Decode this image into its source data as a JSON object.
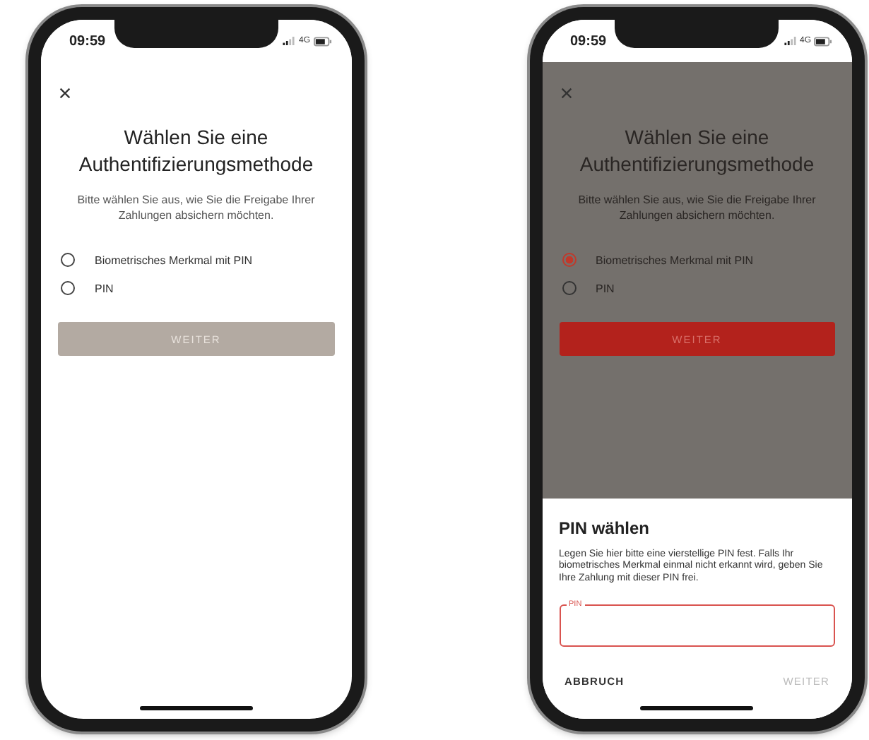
{
  "phones": [
    {
      "status_bar": {
        "time": "09:59",
        "network": "4G"
      },
      "dimmed": false,
      "title": "Wählen Sie eine Authentifizierungsmethode",
      "subtitle": "Bitte wählen Sie aus, wie Sie die Freigabe Ihrer Zahlungen absichern möchten.",
      "options": [
        {
          "label": "Biometrisches Merkmal mit PIN",
          "selected": false
        },
        {
          "label": "PIN",
          "selected": false
        }
      ],
      "button": {
        "label": "WEITER",
        "enabled": false
      }
    },
    {
      "status_bar": {
        "time": "09:59",
        "network": "4G"
      },
      "dimmed": true,
      "title": "Wählen Sie eine Authentifizierungsmethode",
      "subtitle": "Bitte wählen Sie aus, wie Sie die Freigabe Ihrer Zahlungen absichern möchten.",
      "options": [
        {
          "label": "Biometrisches Merkmal mit PIN",
          "selected": true
        },
        {
          "label": "PIN",
          "selected": false
        }
      ],
      "button": {
        "label": "WEITER",
        "enabled": true
      },
      "sheet": {
        "title": "PIN wählen",
        "body": "Legen Sie hier bitte eine vierstellige PIN fest. Falls Ihr biometrisches Merkmal einmal nicht erkannt wird, geben Sie Ihre Zahlung mit dieser PIN frei.",
        "field": {
          "label": "PIN"
        },
        "buttons": [
          {
            "label": "ABBRUCH",
            "enabled": true
          },
          {
            "label": "WEITER",
            "enabled": false
          }
        ]
      }
    }
  ]
}
